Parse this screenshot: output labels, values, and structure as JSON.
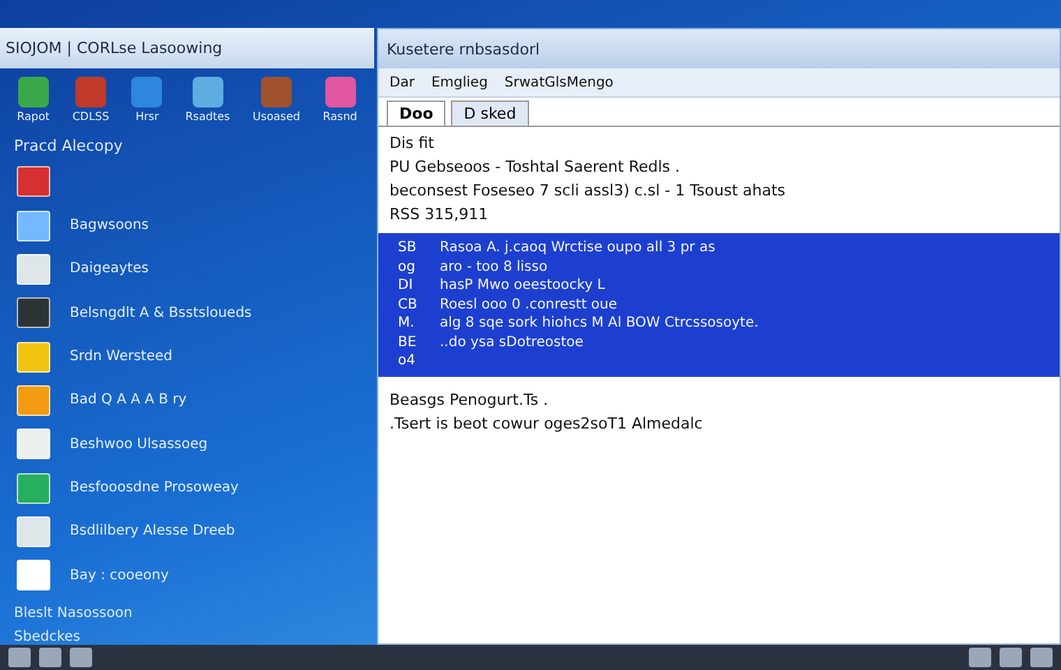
{
  "left_panel": {
    "title": "SIOJOM | CORLse Lasoowing",
    "shortcuts": [
      {
        "label": "Rapot",
        "color": "#3aa84a"
      },
      {
        "label": "CDLSS",
        "color": "#c0392b"
      },
      {
        "label": "Hrsr",
        "color": "#2e86de"
      },
      {
        "label": "Rsadtes",
        "color": "#5dade2"
      },
      {
        "label": "Usoased",
        "color": "#a0522d"
      },
      {
        "label": "Rasnd",
        "color": "#e056a0"
      }
    ],
    "heading": "Pracd Alecopy",
    "items": [
      {
        "color": "#d63031"
      },
      {
        "label": "Bagwsoons",
        "color": "#74b9ff"
      },
      {
        "label": "Daigeaytes",
        "color": "#dfe6e9"
      },
      {
        "label": "Belsngdlt A & Bsstsloueds",
        "color": "#2d3436"
      },
      {
        "label": "Srdn Wersteed",
        "color": "#f1c40f"
      },
      {
        "label": "Bad Q A A A B ry",
        "color": "#f39c12"
      },
      {
        "label": "Beshwoo Ulsassoeg",
        "color": "#ecf0f1"
      },
      {
        "label": "Besfooosdne Prosoweay",
        "color": "#27ae60"
      },
      {
        "label": "Bsdlilbery Alesse Dreeb",
        "color": "#dfe6e9"
      },
      {
        "label": "Bay : cooeony",
        "color": "#ffffff"
      }
    ],
    "footer": [
      "Bleslt Nasossoon",
      "Sbedckes"
    ]
  },
  "window": {
    "title": "Kusetere rnbsasdorl",
    "toolbar": [
      "Dar",
      "Emglieg",
      "SrwatGlsMengo"
    ],
    "tabs": [
      {
        "label": "Doo",
        "selected": true
      },
      {
        "label": "D sked",
        "selected": false
      }
    ],
    "lines": [
      "Dis fit",
      "PU Gebseoos -  Toshtal Saerent Redls .",
      "beconsest Foseseo  7  scli assl3) c.sl  -  1  Tsoust ahats",
      "RSS 315,911"
    ],
    "selection_lines": [
      {
        "num": "SB",
        "text": "Rasoa A.   j.caoq   Wrctise oupo   all 3 pr as"
      },
      {
        "num": "og",
        "text": "aro - too   8 lisso"
      },
      {
        "num": "DI",
        "text": "hasP  Mwo oeestoocky    L"
      },
      {
        "num": "CB",
        "text": "Roesl ooo  0   .conrestt oue"
      },
      {
        "num": "M.",
        "text": "alg 8 sqe sork hiohcs  M   Al BOW Ctrcssosoyte."
      },
      {
        "num": "BE",
        "text": "..do ysa sDotreostoe"
      },
      {
        "num": "o4"
      }
    ],
    "notes": [
      "Beasgs Penogurt.Ts .",
      ".Tsert  is  beot  cowur oges2soT1 Almedalc"
    ]
  }
}
